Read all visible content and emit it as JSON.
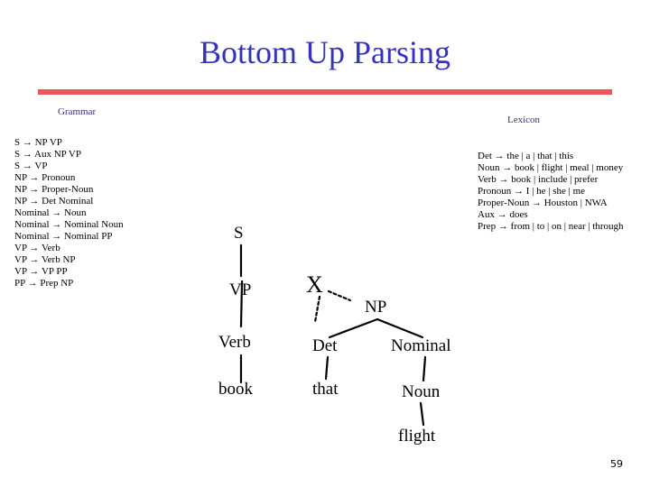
{
  "slide": {
    "title": "Bottom Up Parsing",
    "page_number": "59",
    "accent_color": "#f05555",
    "title_color": "#3333bb"
  },
  "grammar": {
    "label": "Grammar",
    "rules": [
      "S → NP VP",
      "S → Aux NP VP",
      "S → VP",
      "NP → Pronoun",
      "NP → Proper-Noun",
      "NP → Det Nominal",
      "Nominal → Noun",
      "Nominal → Nominal Noun",
      "Nominal → Nominal PP",
      "VP → Verb",
      "VP → Verb NP",
      "VP → VP PP",
      "PP → Prep NP"
    ]
  },
  "lexicon": {
    "label": "Lexicon",
    "entries": [
      "Det → the | a | that | this",
      "Noun → book | flight | meal | money",
      "Verb → book | include | prefer",
      "Pronoun → I | he | she | me",
      "Proper-Noun → Houston | NWA",
      "Aux → does",
      "Prep → from | to | on | near | through"
    ]
  },
  "tree": {
    "nodes": {
      "s": "S",
      "vp": "VP",
      "verb": "Verb",
      "book": "book",
      "x": "X",
      "np": "NP",
      "det": "Det",
      "that": "that",
      "nominal": "Nominal",
      "noun": "Noun",
      "flight": "flight"
    },
    "edges": [
      {
        "from": "s",
        "to": "vp",
        "style": "solid"
      },
      {
        "from": "vp",
        "to": "verb",
        "style": "solid"
      },
      {
        "from": "verb",
        "to": "book",
        "style": "solid"
      },
      {
        "from": "x",
        "to": "np",
        "style": "dotted"
      },
      {
        "from": "x",
        "to": "det",
        "style": "dotted"
      },
      {
        "from": "np",
        "to": "det",
        "style": "solid"
      },
      {
        "from": "np",
        "to": "nominal",
        "style": "solid"
      },
      {
        "from": "det",
        "to": "that",
        "style": "solid"
      },
      {
        "from": "nominal",
        "to": "noun",
        "style": "solid"
      },
      {
        "from": "noun",
        "to": "flight",
        "style": "solid"
      }
    ]
  }
}
